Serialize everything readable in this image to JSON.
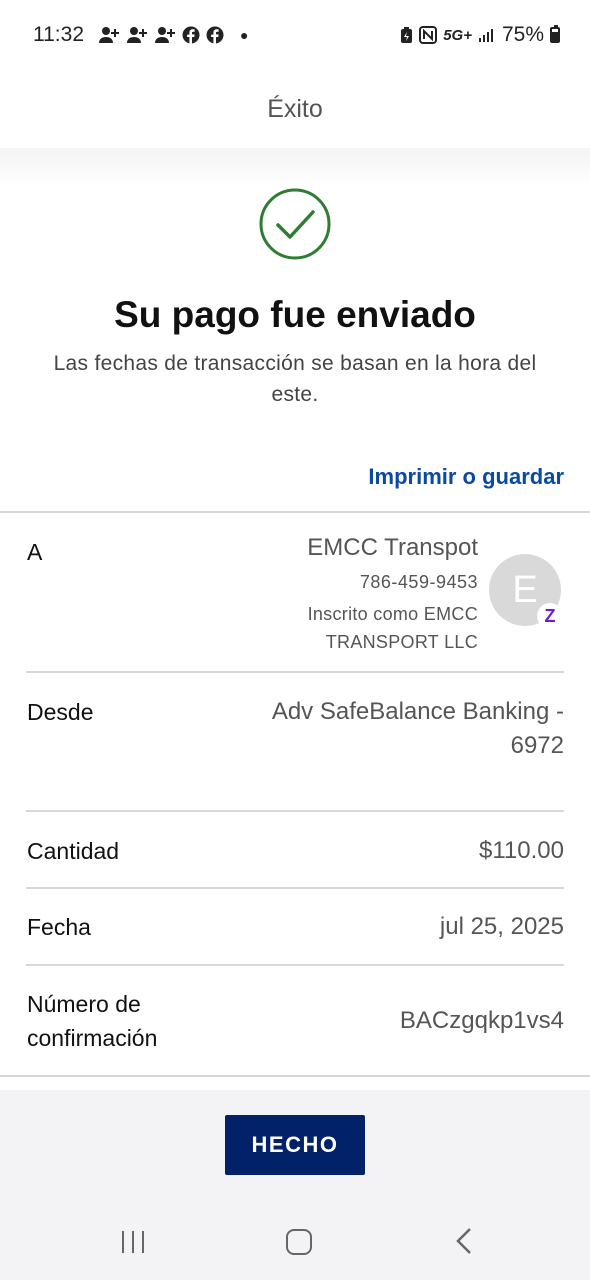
{
  "status_bar": {
    "time": "11:32",
    "network": "5G+",
    "battery": "75%",
    "icons": [
      "person-add-icon",
      "person-add-icon",
      "person-add-icon",
      "facebook-icon",
      "facebook-icon",
      "dot-icon",
      "battery-saver-icon",
      "nfc-icon",
      "5g-icon",
      "signal-icon",
      "battery-icon"
    ]
  },
  "header": {
    "title": "Éxito"
  },
  "success": {
    "icon": "check-circle-icon",
    "title": "Su pago fue enviado",
    "subtitle": "Las fechas de transacción se basan en la hora del este.",
    "print_link": "Imprimir o guardar"
  },
  "details": {
    "to": {
      "label": "A",
      "name": "EMCC Transpot",
      "phone": "786-459-9453",
      "enrolled": "Inscrito como EMCC TRANSPORT LLC",
      "avatar_letter": "E",
      "badge": "Z"
    },
    "from": {
      "label": "Desde",
      "value": "Adv SafeBalance Banking - 6972"
    },
    "amount": {
      "label": "Cantidad",
      "value": "$110.00"
    },
    "date": {
      "label": "Fecha",
      "value": "jul 25, 2025"
    },
    "confirmation": {
      "label": "Número de confirmación",
      "value": "BACzgqkp1vs4"
    }
  },
  "footer": {
    "done_label": "HECHO"
  },
  "colors": {
    "accent": "#012169",
    "link": "#0a4aa0",
    "success": "#2e7d32",
    "zelle": "#6d1ed4"
  }
}
